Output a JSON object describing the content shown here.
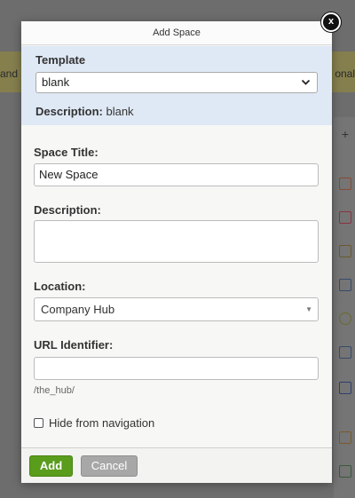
{
  "background": {
    "banner_left_text": "and",
    "banner_right_text": "onal",
    "sidebar_plus": "+"
  },
  "modal": {
    "title": "Add Space",
    "close_label": "x",
    "template": {
      "label": "Template",
      "selected": "blank",
      "description_label": "Description:",
      "description_value": "blank"
    },
    "space_title": {
      "label": "Space Title:",
      "value": "New Space"
    },
    "description": {
      "label": "Description:",
      "value": ""
    },
    "location": {
      "label": "Location:",
      "selected": "Company Hub"
    },
    "url_identifier": {
      "label": "URL Identifier:",
      "value": "",
      "hint": "/the_hub/"
    },
    "hide_from_navigation": {
      "label": "Hide from navigation",
      "checked": false
    },
    "buttons": {
      "add": "Add",
      "cancel": "Cancel"
    }
  },
  "colors": {
    "accent_green": "#5a9c1c",
    "template_panel": "#dfe9f5",
    "cancel_gray": "#a7a7a7"
  }
}
